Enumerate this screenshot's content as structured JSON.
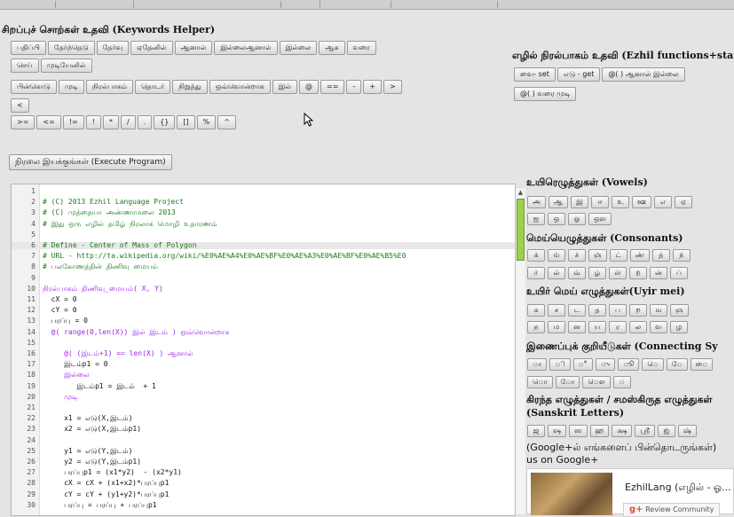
{
  "keywords_helper": {
    "title": "சிறப்புச் சொற்கள் உதவி (Keywords Helper)",
    "row1": [
      "பதிப்பி",
      "தேர்ந்தெடு",
      "தேர்வு",
      "ஏதேனில்",
      "ஆனால்",
      "இல்லைஆனால்",
      "இல்லை",
      "ஆக",
      "வரை"
    ],
    "row2": [
      "செய்",
      "முடியேனில்"
    ],
    "row3": [
      "பின்கொடு",
      "முடி",
      "நிரல்பாகம்",
      "தொடர்",
      "நிறுத்து",
      "ஒவ்வொன்றாக",
      "இல்",
      "@",
      "==",
      "-",
      "+",
      ">"
    ],
    "row4": [
      "<"
    ],
    "row5": [
      ">=",
      "<=",
      "!=",
      "!",
      "*",
      "/",
      ".",
      "{}",
      "[]",
      "%",
      "^"
    ]
  },
  "functions_helper": {
    "title": "எழில் நிரல்பாகம் உதவி (Ezhil functions+stat",
    "row1": [
      "வை- set",
      "எடு - get",
      "@( ) ஆனால் இல்லை"
    ],
    "row2": [
      "@( ) வரை முடி"
    ]
  },
  "execute_button": "நிரலை இயக்குங்கள் (Execute Program)",
  "editor": {
    "lines": [
      {
        "n": "1",
        "t": "",
        "cls": ""
      },
      {
        "n": "2",
        "t": "# (C) 2013 Ezhil Language Project",
        "cls": "c-comment"
      },
      {
        "n": "3",
        "t": "# (C) முத்தையா அண்ணாமலை 2013",
        "cls": "c-comment"
      },
      {
        "n": "4",
        "t": "# இது ஒரு எழில் தமிழ் நிரலாக மொழி உதாரணம்",
        "cls": "c-comment"
      },
      {
        "n": "5",
        "t": "",
        "cls": ""
      },
      {
        "n": "6",
        "t": "# Define - Center of Mass of Polygon",
        "cls": "c-comment",
        "hl": true
      },
      {
        "n": "7",
        "t": "# URL - http://ta.wikipedia.org/wiki/%E0%AE%A4%E0%AE%BF%E0%AE%A3%E0%AE%BF%E0%AE%B5%E0",
        "cls": "c-comment"
      },
      {
        "n": "8",
        "t": "# பலகோணத்தின் திணிவு மையம்",
        "cls": "c-comment"
      },
      {
        "n": "9",
        "t": "",
        "cls": ""
      },
      {
        "n": "10",
        "t": "நிரல்பாகம் திணிவு_மையம்( X, Y)",
        "cls": "c-kw"
      },
      {
        "n": "11",
        "t": "  cX = 0",
        "cls": "c-def"
      },
      {
        "n": "12",
        "t": "  cY = 0",
        "cls": "c-def"
      },
      {
        "n": "13",
        "t": "  பரப்பு = 0",
        "cls": "c-def"
      },
      {
        "n": "14",
        "t": "  @( range(0,len(X)) இல் இடம் ) ஒவ்வொன்றாக",
        "cls": "c-kw"
      },
      {
        "n": "15",
        "t": "",
        "cls": ""
      },
      {
        "n": "16",
        "t": "     @( (இடம்+1) == len(X) ) ஆனால்",
        "cls": "c-kw"
      },
      {
        "n": "17",
        "t": "     இடம்p1 = 0",
        "cls": "c-def"
      },
      {
        "n": "18",
        "t": "     இல்லை",
        "cls": "c-kw"
      },
      {
        "n": "19",
        "t": "        இடம்p1 = இடம்  + 1",
        "cls": "c-def"
      },
      {
        "n": "20",
        "t": "     முடி",
        "cls": "c-kw"
      },
      {
        "n": "21",
        "t": "",
        "cls": ""
      },
      {
        "n": "22",
        "t": "     x1 = எடு(X,இடம்)",
        "cls": "c-def"
      },
      {
        "n": "23",
        "t": "     x2 = எடு(X,இடம்p1)",
        "cls": "c-def"
      },
      {
        "n": "24",
        "t": "",
        "cls": ""
      },
      {
        "n": "25",
        "t": "     y1 = எடு(Y,இடம்)",
        "cls": "c-def"
      },
      {
        "n": "26",
        "t": "     y2 = எடு(Y,இடம்p1)",
        "cls": "c-def"
      },
      {
        "n": "27",
        "t": "     பரப்புp1 = (x1*y2)  - (x2*y1)",
        "cls": "c-def"
      },
      {
        "n": "28",
        "t": "     cX = cX + (x1+x2)*பரப்புp1",
        "cls": "c-def"
      },
      {
        "n": "29",
        "t": "     cY = cY + (y1+y2)*பரப்புp1",
        "cls": "c-def"
      },
      {
        "n": "30",
        "t": "     பரப்பு = பரப்பு + பரப்புp1",
        "cls": "c-def"
      }
    ]
  },
  "vowels": {
    "title": "உயிரெழுத்துகள் (Vowels)",
    "row1": [
      "அ",
      "ஆ",
      "இ",
      "ஈ",
      "உ",
      "ஊ",
      "எ",
      "ஏ"
    ],
    "row2": [
      "ஐ",
      "ஒ",
      "ஓ",
      "ஔ"
    ]
  },
  "consonants": {
    "title": "மெய்யெழுத்துகள் (Consonants)",
    "row1": [
      "க்",
      "ங்",
      "ச்",
      "ஞ்",
      "ட்",
      "ண்",
      "த்",
      "ந்"
    ],
    "row2": [
      "ர்",
      "ல்",
      "வ்",
      "ழ்",
      "ள்",
      "ற்",
      "ன்",
      "ப்"
    ]
  },
  "uyirmei": {
    "title": "உயிர் மெய் எழுத்துகள்(Uyir mei)",
    "row1": [
      "க",
      "ச",
      "ட",
      "த",
      "ப",
      "ற",
      "ங",
      "ஞ"
    ],
    "row2": [
      "ந",
      "ம",
      "ன",
      "ய",
      "ர",
      "ல",
      "வ",
      "ழ"
    ]
  },
  "connecting": {
    "title": "இணைப்புக் குறியீடுகள் (Connecting Sy",
    "row1": [
      "ா",
      "ி",
      "ீ",
      "ு",
      "ூ",
      "ெ",
      "ே",
      "ை"
    ],
    "row2": [
      "ொ",
      "ோ",
      "ௌ",
      "்"
    ]
  },
  "sanskrit": {
    "title": "கிரந்த எழுத்துகள் / சமஸ்கிருத எழுத்துகள்",
    "subtitle": "(Sanskrit Letters)",
    "row1": [
      "ஜ",
      "ஷ",
      "ஸ",
      "ஹ",
      "க்ஷ",
      "ஸ்ரீ",
      "ஜ்",
      "ஷ்"
    ]
  },
  "google": {
    "text1": "(Google+ல் எங்களைப் பின்தொடருங்கள்)",
    "text2": "us on Google+",
    "page_name": "EzhilLang (எழில் - ஓ...",
    "follow": "Review Community"
  }
}
